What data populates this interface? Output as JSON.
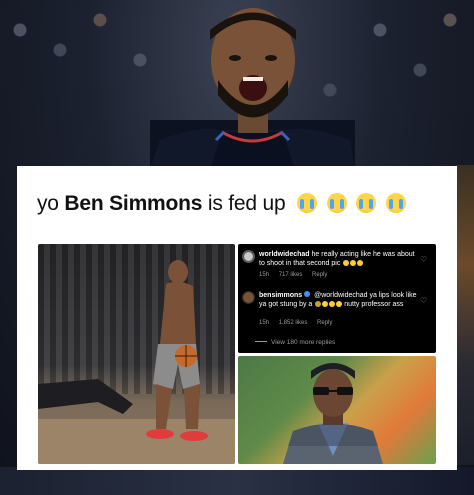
{
  "headline": {
    "prefix": "yo ",
    "name": "Ben Simmons",
    "suffix": " is fed up",
    "emoji_icons": [
      "loudly-crying-face",
      "loudly-crying-face",
      "loudly-crying-face",
      "loudly-crying-face"
    ]
  },
  "comments": [
    {
      "username": "worldwidechad",
      "text": " he really acting like he was about to shoot in that second pic",
      "time": "15h",
      "likes": "717 likes",
      "reply": "Reply"
    },
    {
      "username": "bensimmons",
      "text": " @worldwidechad ya lips look like ya got stung by a",
      "text2": " nutty professor ass",
      "time": "15h",
      "likes": "1,852 likes",
      "reply": "Reply"
    }
  ],
  "view_replies": "View 180 more replies",
  "colors": {
    "card": "#ffffff",
    "comment_bg": "#000000",
    "meta_gray": "#9a9a9a",
    "verified_blue": "#3897f0"
  }
}
